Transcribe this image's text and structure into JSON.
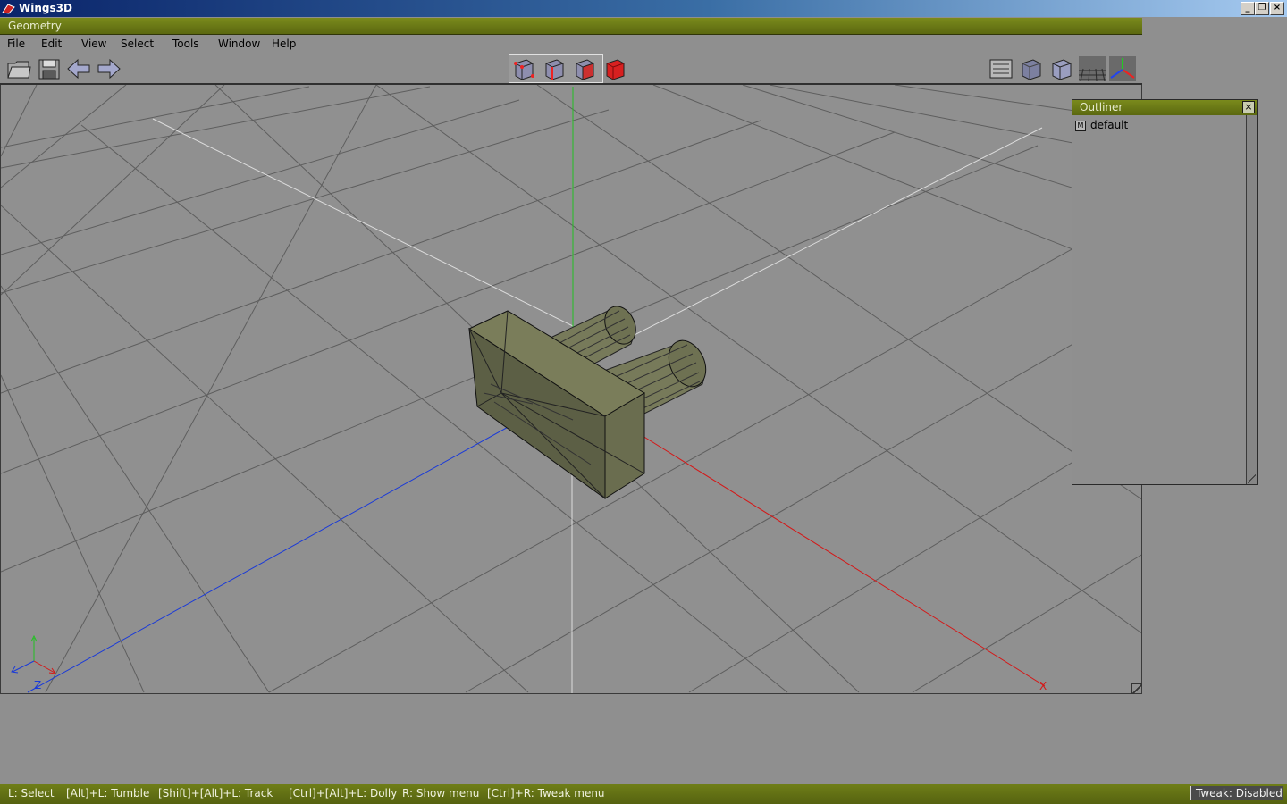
{
  "window": {
    "title": "Wings3D",
    "icons": [
      "wings-app-icon",
      "minimize-icon",
      "restore-icon",
      "close-icon"
    ]
  },
  "geometry": {
    "title": "Geometry"
  },
  "menus": [
    "File",
    "Edit",
    "View",
    "Select",
    "Tools",
    "Window",
    "Help"
  ],
  "toolbar": {
    "left": [
      "open-file-icon",
      "save-file-icon",
      "undo-arrow-icon",
      "redo-arrow-icon"
    ],
    "selection_modes": [
      "vertex-select-icon",
      "edge-select-icon",
      "face-select-icon",
      "body-select-icon"
    ],
    "active_mode": "body-select-icon",
    "right": [
      "view-settings-icon",
      "smooth-shade-icon",
      "flat-shade-icon",
      "ground-grid-icon",
      "axes-icon"
    ]
  },
  "viewport": {
    "axes": {
      "x": "X",
      "z": "Z"
    },
    "colors": {
      "x_axis": "#d41818",
      "y_axis": "#22c022",
      "z_axis": "#1a3ad8",
      "object": "#6b6e4e"
    }
  },
  "outliner": {
    "title": "Outliner",
    "close_glyph": "×",
    "items": [
      {
        "icon": "M",
        "label": "default"
      }
    ]
  },
  "statusbar": {
    "hints": [
      "L: Select",
      "[Alt]+L: Tumble",
      "[Shift]+[Alt]+L: Track",
      "[Ctrl]+[Alt]+L: Dolly",
      "R: Show menu",
      "[Ctrl]+R: Tweak menu"
    ],
    "tweak": "Tweak: Disabled"
  }
}
